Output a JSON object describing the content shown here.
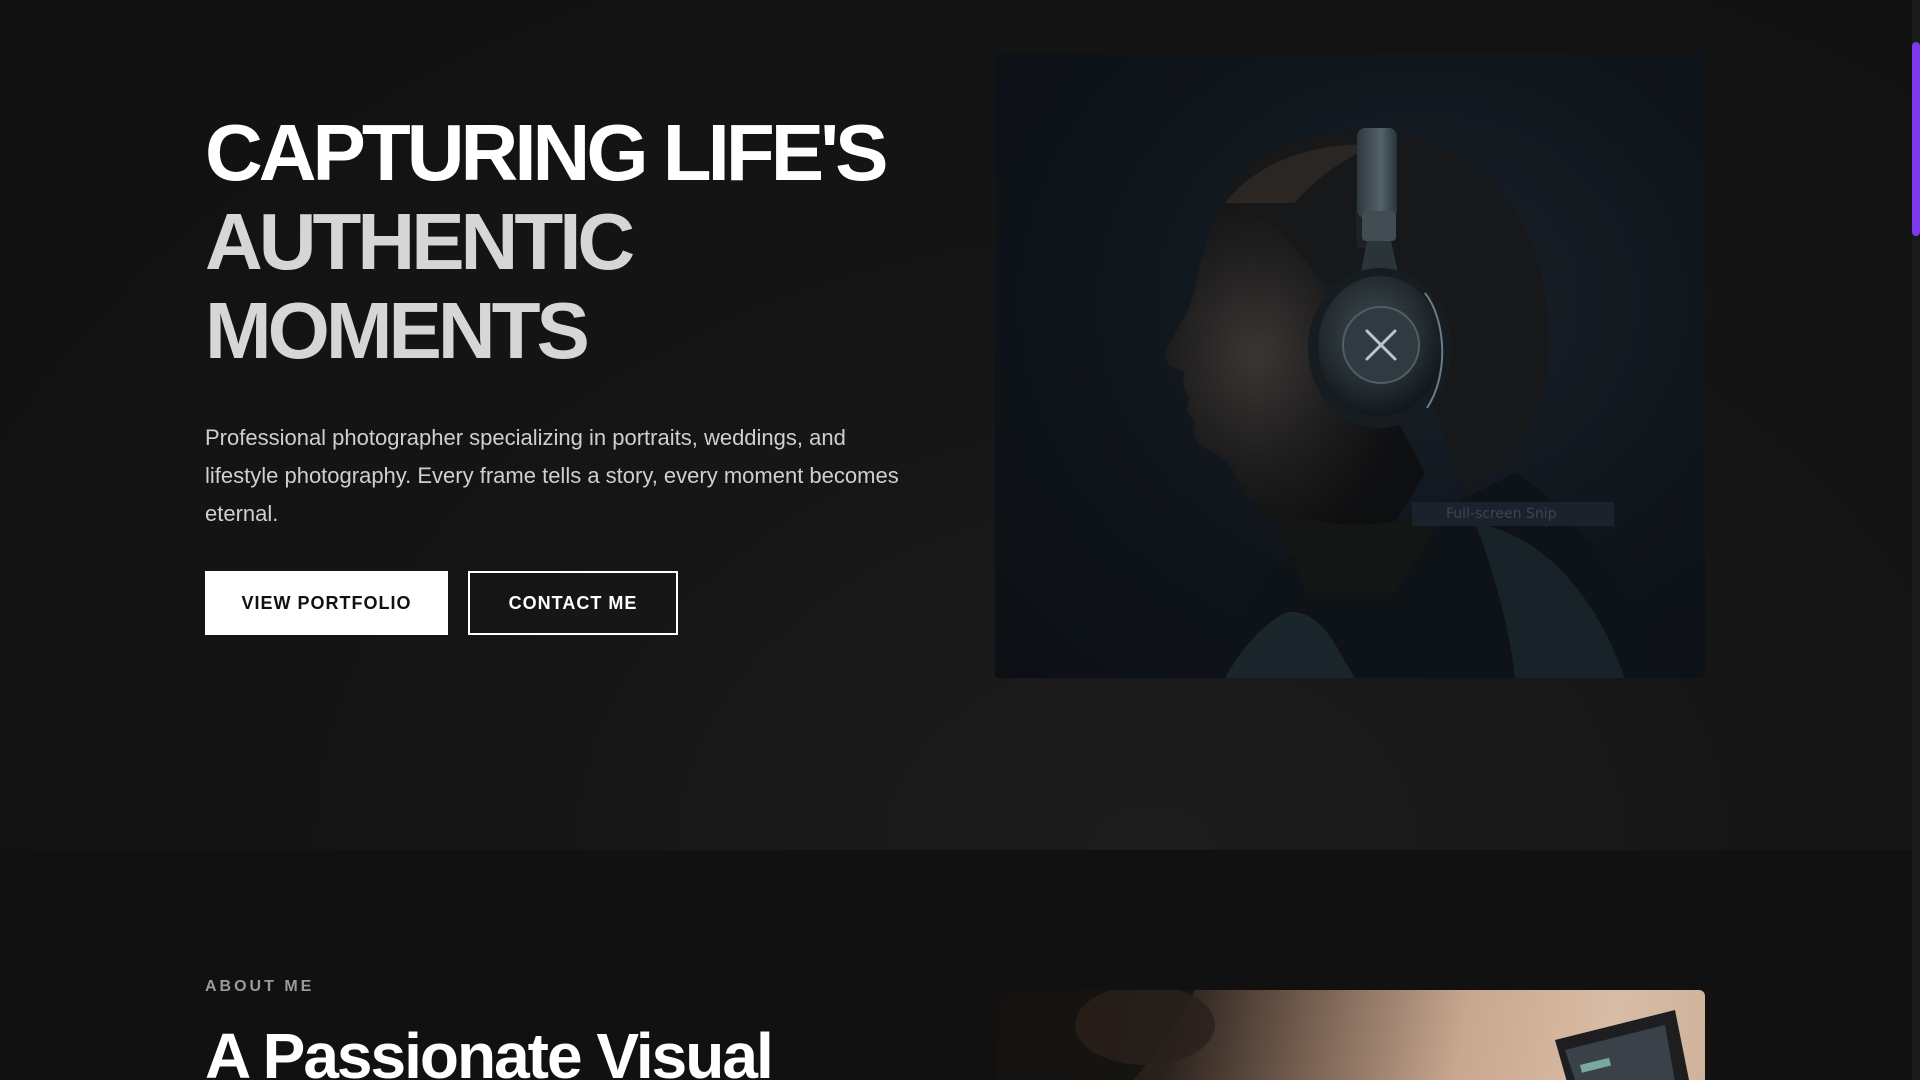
{
  "hero": {
    "headline": {
      "line1": "CAPTURING LIFE'S",
      "line2": "AUTHENTIC",
      "line3": "MOMENTS"
    },
    "description": "Professional photographer specializing in portraits, weddings, and lifestyle photography. Every frame tells a story, every moment becomes eternal.",
    "primary_button": "VIEW PORTFOLIO",
    "secondary_button": "CONTACT ME",
    "photo_overlay_text": "Full-screen Snip"
  },
  "about": {
    "eyebrow": "ABOUT ME",
    "title": "A Passionate Visual"
  },
  "colors": {
    "background": "#111111",
    "accent_scrollbar": "#7c3aed",
    "text_primary": "#ffffff",
    "text_muted": "#cfcfcf"
  },
  "icons": {
    "headphone_logo": "x-mark-icon"
  }
}
